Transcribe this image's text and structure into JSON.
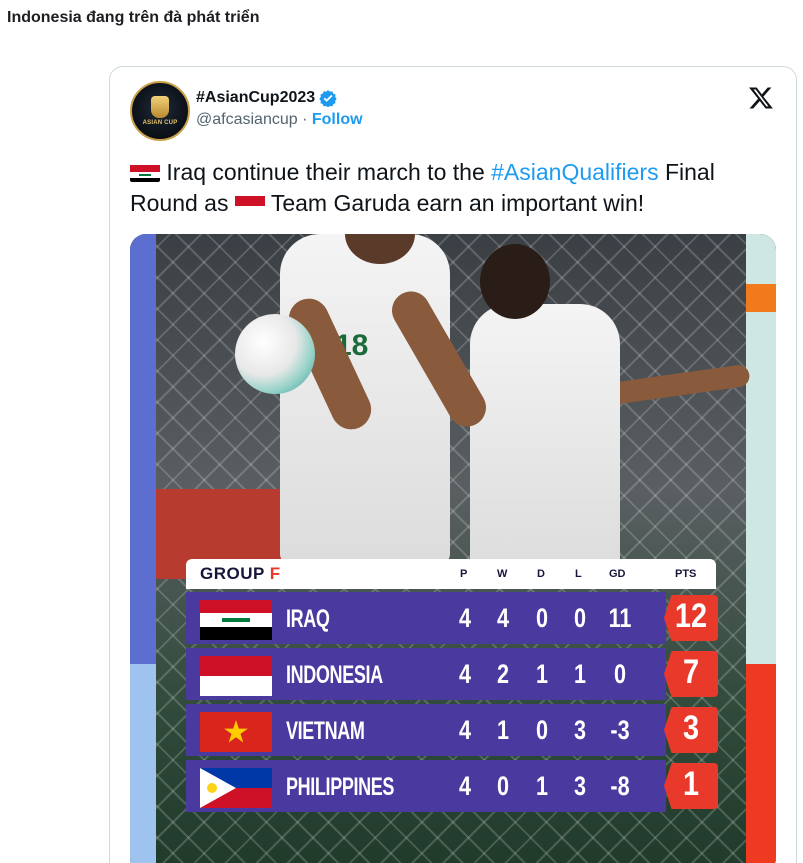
{
  "post": {
    "title": "Indonesia đang trên đà phát triển"
  },
  "tweet": {
    "display_name": "#AsianCup2023",
    "handle": "@afcasiancup",
    "separator": "·",
    "follow_label": "Follow",
    "avatar_text": "ASIAN CUP",
    "text": {
      "part1": " Iraq continue their march to the ",
      "hashtag": "#AsianQualifiers",
      "part2": " Final Round as ",
      "part3": " Team Garuda earn an important win!"
    }
  },
  "standings": {
    "group_word": "GROUP",
    "group_letter": "F",
    "columns": [
      "P",
      "W",
      "D",
      "L",
      "GD",
      "PTS"
    ],
    "rows": [
      {
        "team": "IRAQ",
        "flag": "iraq-flag",
        "p": "4",
        "w": "4",
        "d": "0",
        "l": "0",
        "gd": "11",
        "pts": "12"
      },
      {
        "team": "INDONESIA",
        "flag": "indonesia-flag",
        "p": "4",
        "w": "2",
        "d": "1",
        "l": "1",
        "gd": "0",
        "pts": "7"
      },
      {
        "team": "VIETNAM",
        "flag": "vietnam-flag",
        "p": "4",
        "w": "1",
        "d": "0",
        "l": "3",
        "gd": "-3",
        "pts": "3"
      },
      {
        "team": "PHILIPPINES",
        "flag": "philippines-flag",
        "p": "4",
        "w": "0",
        "d": "1",
        "l": "3",
        "gd": "-8",
        "pts": "1"
      }
    ]
  },
  "colors": {
    "link": "#1d9bf0",
    "row_purple": "#4a3aa0",
    "pts_red": "#e8392a"
  },
  "icons": {
    "verified": "verified-badge-icon",
    "platform": "x-logo-icon"
  }
}
